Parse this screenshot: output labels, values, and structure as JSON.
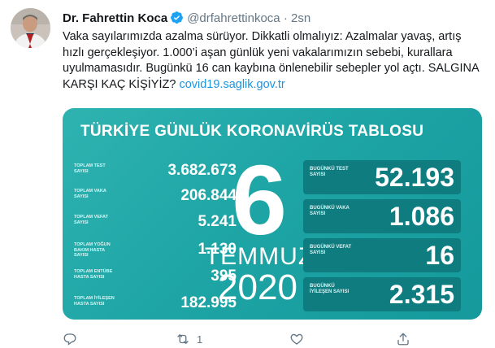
{
  "tweet": {
    "author_name": "Dr. Fahrettin Koca",
    "handle": "@drfahrettinkoca",
    "separator": "·",
    "time": "2sn",
    "text_main": "Vaka sayılarımızda azalma sürüyor. Dikkatli olmalıyız: Azalmalar yavaş, artış hızlı gerçekleşiyor. 1.000’i aşan günlük yeni vakalarımızın sebebi, kurallara uyulmamasıdır. Bugünkü 16 can kaybına önlenebilir sebepler yol açtı. SALGINA KARŞI KAÇ KİŞİYİZ? ",
    "text_link": "covid19.saglik.gov.tr"
  },
  "card": {
    "title": "TÜRKİYE GÜNLÜK KORONAVİRÜS TABLOSU",
    "totals": [
      {
        "label": "TOPLAM TEST SAYISI",
        "value": "3.682.673"
      },
      {
        "label": "TOPLAM VAKA SAYISI",
        "value": "206.844"
      },
      {
        "label": "TOPLAM VEFAT SAYISI",
        "value": "5.241"
      },
      {
        "label": "TOPLAM YOĞUN BAKIM HASTA SAYISI",
        "value": "1.130"
      },
      {
        "label": "TOPLAM ENTÜBE HASTA SAYISI",
        "value": "395"
      },
      {
        "label": "TOPLAM İYİLEŞEN HASTA SAYISI",
        "value": "182.995"
      }
    ],
    "date": {
      "day": "6",
      "month": "TEMMUZ",
      "year": "2020"
    },
    "today": [
      {
        "label": "BUGÜNKÜ TEST SAYISI",
        "value": "52.193"
      },
      {
        "label": "BUGÜNKÜ VAKA SAYISI",
        "value": "1.086"
      },
      {
        "label": "BUGÜNKÜ VEFAT SAYISI",
        "value": "16"
      },
      {
        "label": "BUGÜNKÜ İYİLEŞEN SAYISI",
        "value": "2.315"
      }
    ]
  },
  "actions": {
    "reply_icon": "reply-icon",
    "retweet_icon": "retweet-icon",
    "like_icon": "like-icon",
    "share_icon": "share-icon",
    "retweet_count": "1"
  },
  "colors": {
    "accent": "#1b95e0",
    "card_teal": "#1ea5a5",
    "box_teal": "#0f7c80"
  }
}
